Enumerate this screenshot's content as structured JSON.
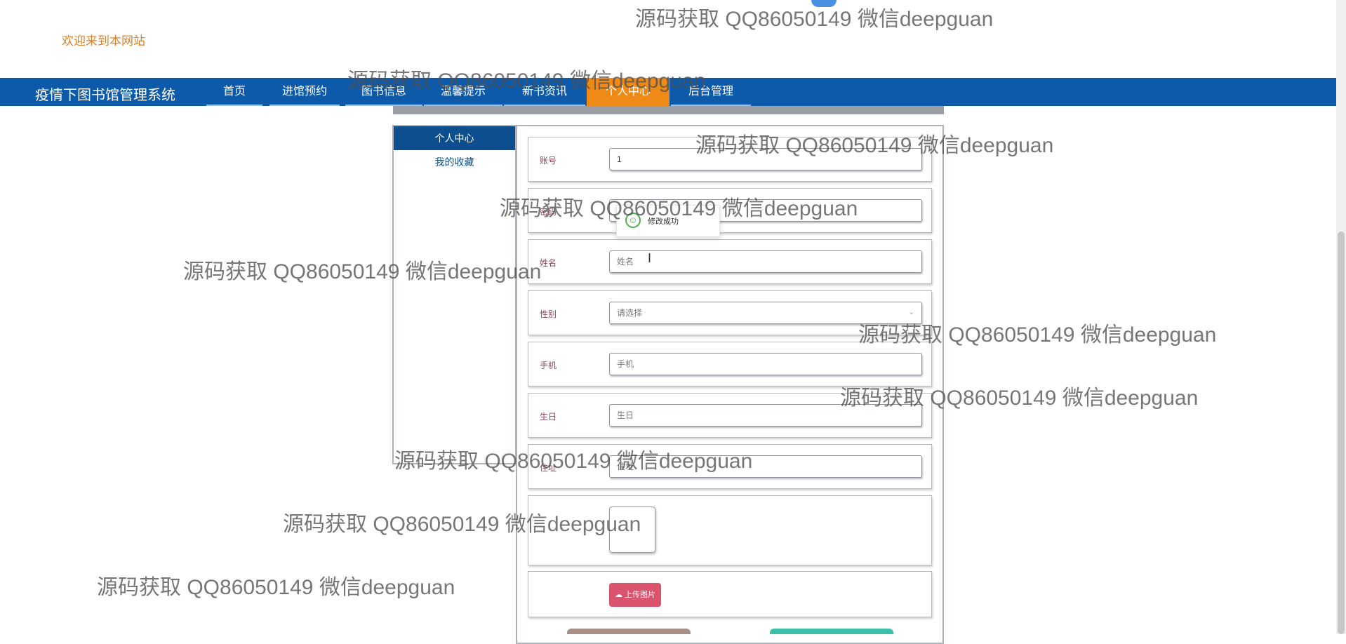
{
  "welcome": "欢迎来到本网站",
  "brand": "疫情下图书馆管理系统",
  "nav": [
    "首页",
    "进馆预约",
    "图书信息",
    "温馨提示",
    "新书资讯",
    "个人中心",
    "后台管理"
  ],
  "sidebar": {
    "title": "个人中心",
    "links": [
      "我的收藏"
    ]
  },
  "form": {
    "account": {
      "label": "账号",
      "value": "1"
    },
    "password": {
      "label": "密码"
    },
    "name": {
      "label": "姓名",
      "placeholder": "姓名"
    },
    "gender": {
      "label": "性别",
      "placeholder": "请选择"
    },
    "phone": {
      "label": "手机",
      "placeholder": "手机"
    },
    "birthday": {
      "label": "生日",
      "placeholder": "生日"
    },
    "address": {
      "label": "住址",
      "placeholder": "住址"
    },
    "upload_label": "上传图片"
  },
  "toast": "修改成功",
  "watermark": "源码获取 QQ86050149 微信deepguan",
  "colors": {
    "nav": "#0c5aa9",
    "active": "#f08a17",
    "upload": "#d9536c",
    "sidebar_title": "#0d4f8e"
  }
}
